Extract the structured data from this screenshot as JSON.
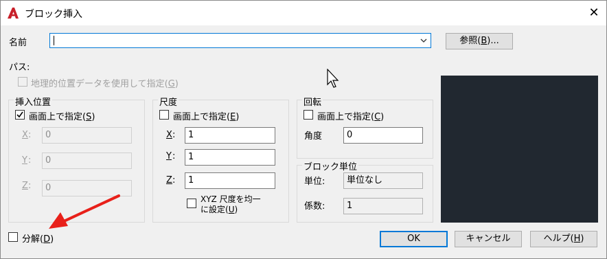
{
  "window": {
    "title": "ブロック挿入",
    "close_glyph": "✕"
  },
  "colors": {
    "accent": "#0078d7",
    "preview_bg": "#212830",
    "arrow": "#e8201a",
    "app_icon": "#c8202a"
  },
  "name": {
    "label": "名前",
    "value": ""
  },
  "browse_button": {
    "prefix": "参照(",
    "key": "B",
    "suffix": ")..."
  },
  "path": {
    "label": "パス:"
  },
  "geo": {
    "prefix": "地理的位置データを使用して指定(",
    "key": "G",
    "suffix": ")"
  },
  "insertion": {
    "title": "挿入位置",
    "onscreen": {
      "prefix": "画面上で指定(",
      "key": "S",
      "suffix": ")",
      "checked": true
    },
    "x": {
      "label": "X",
      "value": "0"
    },
    "y": {
      "label": "Y",
      "value": "0"
    },
    "z": {
      "label": "Z",
      "value": "0"
    }
  },
  "scale": {
    "title": "尺度",
    "onscreen": {
      "prefix": "画面上で指定(",
      "key": "E",
      "suffix": ")",
      "checked": false
    },
    "x": {
      "label": "X",
      "value": "1"
    },
    "y": {
      "label": "Y",
      "value": "1"
    },
    "z": {
      "label": "Z",
      "value": "1"
    },
    "uniform_line1": "XYZ 尺度を均一",
    "uniform_line2": {
      "prefix": "に設定(",
      "key": "U",
      "suffix": ")"
    }
  },
  "rotation": {
    "title": "回転",
    "onscreen": {
      "prefix": "画面上で指定(",
      "key": "C",
      "suffix": ")",
      "checked": false
    },
    "angle_label": "角度",
    "angle_value": "0"
  },
  "block_unit": {
    "title": "ブロック単位",
    "unit_label": "単位:",
    "unit_value": "単位なし",
    "factor_label": "係数:",
    "factor_value": "1"
  },
  "explode": {
    "prefix": "分解(",
    "key": "D",
    "suffix": ")",
    "checked": false
  },
  "buttons": {
    "ok": "OK",
    "cancel": "キャンセル",
    "help": {
      "prefix": "ヘルプ(",
      "key": "H",
      "suffix": ")"
    }
  }
}
